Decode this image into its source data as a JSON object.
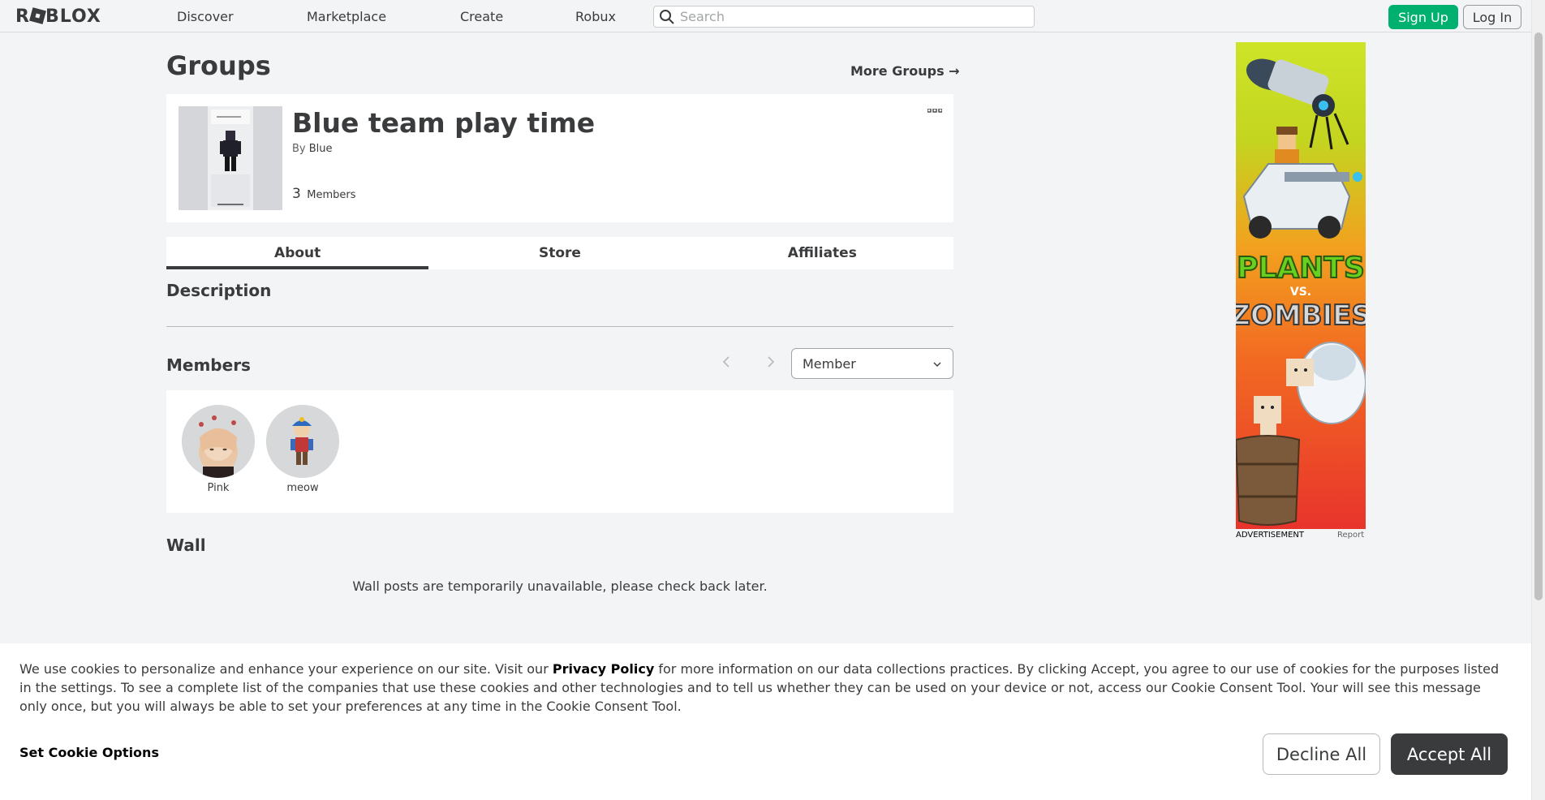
{
  "nav": {
    "logo": "ROBLOX",
    "links": [
      "Discover",
      "Marketplace",
      "Create",
      "Robux"
    ],
    "search_placeholder": "Search",
    "sign_up": "Sign Up",
    "log_in": "Log In"
  },
  "page": {
    "title": "Groups",
    "more_groups": "More Groups →"
  },
  "group": {
    "name": "Blue team play time",
    "by": "By",
    "owner": "Blue",
    "member_count": "3",
    "member_label": "Members"
  },
  "tabs": [
    {
      "label": "About",
      "active": true
    },
    {
      "label": "Store",
      "active": false
    },
    {
      "label": "Affiliates",
      "active": false
    }
  ],
  "sections": {
    "description": "Description",
    "members": "Members",
    "wall": "Wall"
  },
  "members": {
    "role_selected": "Member",
    "list": [
      {
        "name": "Pink"
      },
      {
        "name": "meow"
      }
    ]
  },
  "wall": {
    "message": "Wall posts are temporarily unavailable, please check back later."
  },
  "ad": {
    "label": "ADVERTISEMENT",
    "report": "Report",
    "headline_top": "PLANTS",
    "headline_mid": "VS.",
    "headline_bottom": "ZOMBIES"
  },
  "cookie_banner": {
    "text_before": "We use cookies to personalize and enhance your experience on our site. Visit our ",
    "privacy_link": "Privacy Policy",
    "text_after": " for more information on our data collections practices. By clicking Accept, you agree to our use of cookies for the purposes listed in the settings. To see a complete list of the companies that use these cookies and other technologies and to tell us whether they can be used on your device or not, access our Cookie Consent Tool. Your will see this message only once, but you will always be able to set your preferences at any time in the Cookie Consent Tool.",
    "set_options": "Set Cookie Options",
    "decline": "Decline All",
    "accept": "Accept All"
  },
  "colors": {
    "background": "#f2f4f5",
    "text": "#393b3d",
    "signup_green": "#00b06f",
    "accept_dark": "#393b3d"
  }
}
